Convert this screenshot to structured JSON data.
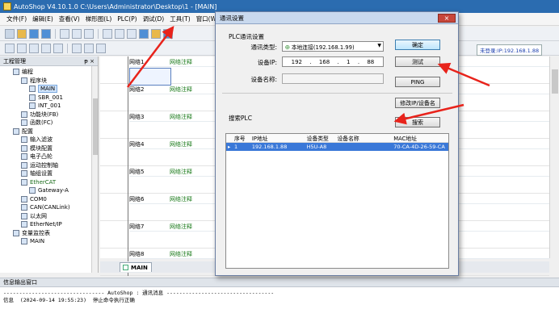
{
  "window": {
    "title": "AutoShop V4.10.1.0  C:\\Users\\Administrator\\Desktop\\1 - [MAIN]"
  },
  "menu": [
    "文件(F)",
    "编辑(E)",
    "查看(V)",
    "梯形图(L)",
    "PLC(P)",
    "调试(D)",
    "工具(T)",
    "窗口(W)"
  ],
  "status": {
    "connection": "未登录:IP:192.168.1.88"
  },
  "left_panel": {
    "title": "工程管理",
    "pin": "ᵽ ×",
    "tree": [
      {
        "label": "编程",
        "indent": 1
      },
      {
        "label": "程序块",
        "indent": 2
      },
      {
        "label": "MAIN",
        "indent": 3,
        "selected": true
      },
      {
        "label": "SBR_001",
        "indent": 3
      },
      {
        "label": "INT_001",
        "indent": 3
      },
      {
        "label": "功能块(FB)",
        "indent": 2
      },
      {
        "label": "函数(FC)",
        "indent": 2
      },
      {
        "label": "配置",
        "indent": 1
      },
      {
        "label": "输入滤波",
        "indent": 2
      },
      {
        "label": "模块配置",
        "indent": 2
      },
      {
        "label": "电子凸轮",
        "indent": 2
      },
      {
        "label": "运动控制轴",
        "indent": 2
      },
      {
        "label": "轴组设置",
        "indent": 2
      },
      {
        "label": "EtherCAT",
        "indent": 2,
        "green": true
      },
      {
        "label": "Gateway-A",
        "indent": 3
      },
      {
        "label": "COM0",
        "indent": 2
      },
      {
        "label": "CAN(CANLink)",
        "indent": 2
      },
      {
        "label": "以太网",
        "indent": 2
      },
      {
        "label": "EtherNet/IP",
        "indent": 2
      },
      {
        "label": "变量监控表",
        "indent": 1
      },
      {
        "label": "MAIN",
        "indent": 2
      }
    ]
  },
  "ladder": {
    "networks": [
      {
        "name": "网络1",
        "comment": "网络注释"
      },
      {
        "name": "网络2",
        "comment": "网络注释"
      },
      {
        "name": "网络3",
        "comment": "网络注释"
      },
      {
        "name": "网络4",
        "comment": "网络注释"
      },
      {
        "name": "网络5",
        "comment": "网络注释"
      },
      {
        "name": "网络6",
        "comment": "网络注释"
      },
      {
        "name": "网络7",
        "comment": "网络注释"
      },
      {
        "name": "网络8",
        "comment": "网络注释"
      }
    ],
    "tab": "MAIN"
  },
  "output": {
    "title": "信息输出窗口",
    "lines": [
      "-------------------------------- AutoShop : 通讯消息 ----------------------------------",
      "信息  (2024-09-14 19:55:23)  停止命令执行正确"
    ]
  },
  "dialog": {
    "title": "通讯设置",
    "close": "×",
    "plc_group": "PLC通讯设置",
    "conn_type_label": "通讯类型:",
    "conn_type_value": "本地连接(192.168.1.99)",
    "ip_label": "设备IP:",
    "ip": [
      "192",
      "168",
      "1",
      "88"
    ],
    "device_name_label": "设备名称:",
    "ok_button": "确定",
    "test_button": "测试",
    "ping_button": "PING",
    "modify_button": "修改IP/设备名",
    "search_group": "搜索PLC",
    "search_button": "搜索",
    "columns": [
      "序号",
      "IP地址",
      "设备类型",
      "设备名称",
      "MAC地址"
    ],
    "rows": [
      {
        "no": "1",
        "ip": "192.168.1.88",
        "type": "H5U-A8",
        "name": "",
        "mac": "70-CA-4D-26-59-CA"
      }
    ]
  }
}
